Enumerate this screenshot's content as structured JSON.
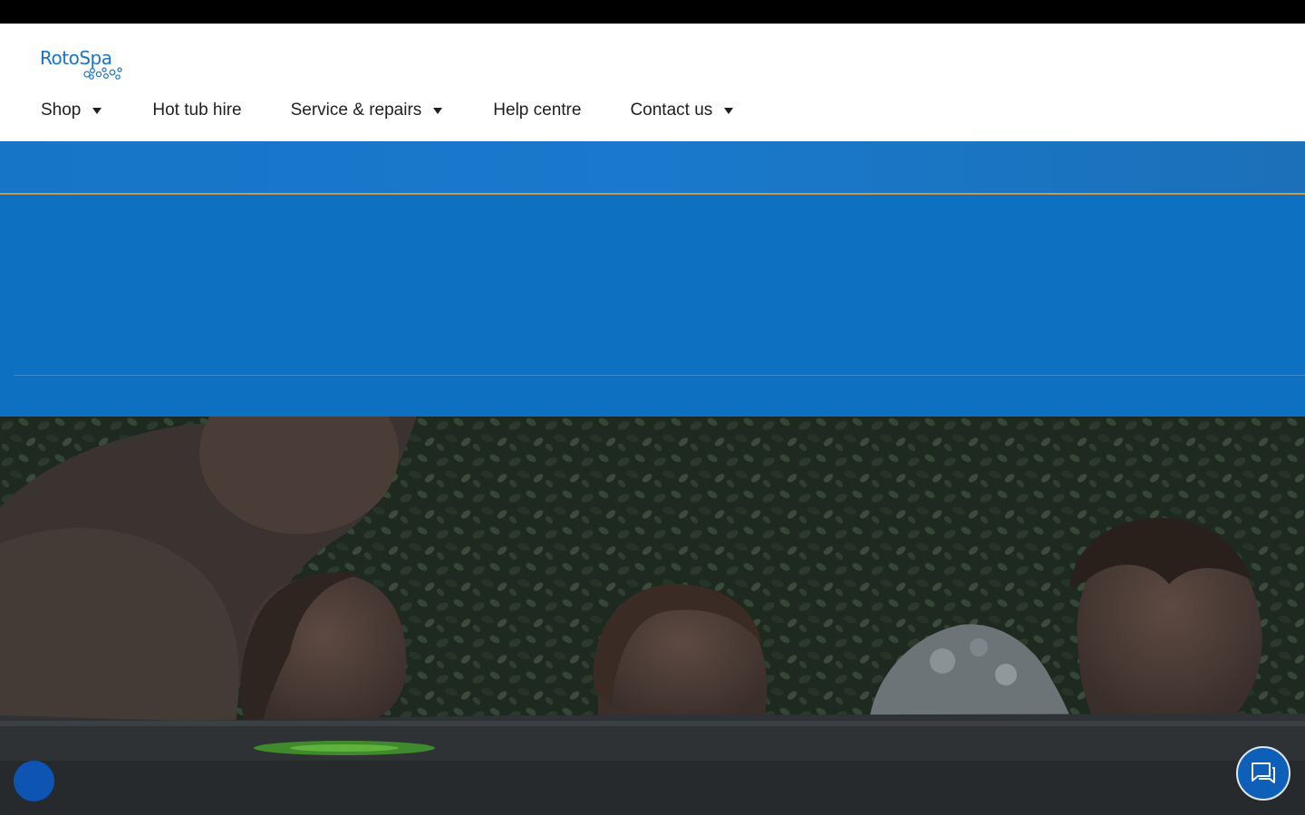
{
  "brand": {
    "name": "RotoSpa",
    "color": "#1a73c9"
  },
  "nav": {
    "items": [
      {
        "label": "Shop",
        "has_dropdown": true
      },
      {
        "label": "Hot tub hire",
        "has_dropdown": false
      },
      {
        "label": "Service & repairs",
        "has_dropdown": true
      },
      {
        "label": "Help centre",
        "has_dropdown": false
      },
      {
        "label": "Contact us",
        "has_dropdown": true
      }
    ]
  },
  "colors": {
    "primary_blue": "#0e70c0",
    "promo_blue": "#1a79cc",
    "accent_gold": "#c8974a",
    "chat_button": "#0d5fb8",
    "cookie_button": "#0d54b3"
  },
  "icons": {
    "chat": "chat-bubble-icon",
    "dropdown": "caret-down-icon"
  }
}
